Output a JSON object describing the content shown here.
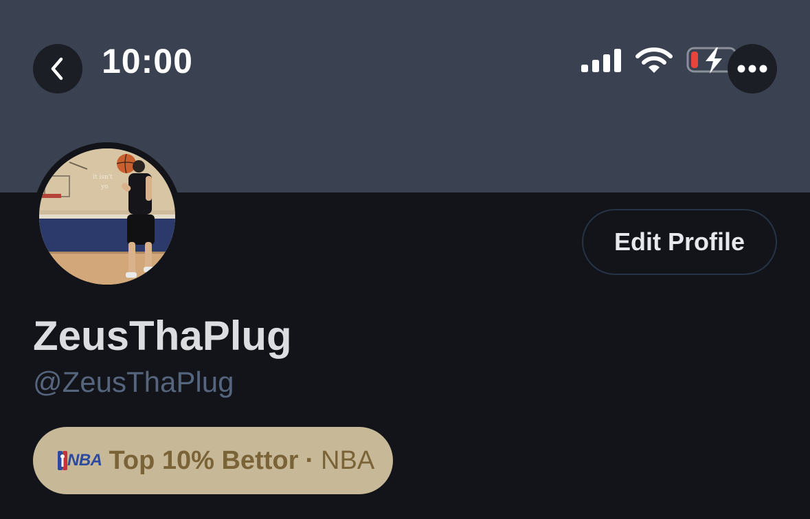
{
  "status_bar": {
    "time": "10:00",
    "signal_icon": "cellular-signal-icon",
    "wifi_icon": "wifi-icon",
    "battery_icon": "battery-charging-icon",
    "battery_level": 0.1,
    "battery_color": "#e8443a"
  },
  "nav": {
    "back_icon": "chevron-left-icon",
    "more_icon": "more-horizontal-icon"
  },
  "profile": {
    "avatar_icon": "profile-photo-avatar",
    "edit_label": "Edit Profile",
    "display_name": "ZeusThaPlug",
    "handle": "@ZeusThaPlug",
    "badge": {
      "logo_text": "NBA",
      "title": "Top 10% Bettor",
      "separator": "·",
      "league": "NBA"
    }
  },
  "colors": {
    "banner": "#3a4150",
    "background": "#121419",
    "badge_bg": "#c7b898",
    "badge_text": "#7b6338",
    "handle_text": "#55657e"
  }
}
